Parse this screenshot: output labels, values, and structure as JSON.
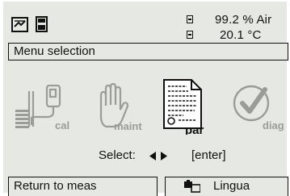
{
  "status": {
    "readings": [
      "99.2 % Air",
      "20.1 °C"
    ],
    "icons": [
      "calibration-status-icon",
      "sensor-status-icon"
    ]
  },
  "menu": {
    "title": "Menu selection",
    "items": [
      {
        "label": "cal",
        "icon": "calibration-icon"
      },
      {
        "label": "maint",
        "icon": "hand-icon"
      },
      {
        "label": "par",
        "icon": "document-icon"
      },
      {
        "label": "diag",
        "icon": "checkmark-icon"
      }
    ]
  },
  "select": {
    "label": "Select:",
    "arrows": "◀ ▶",
    "enter": "[enter]"
  },
  "softkeys": {
    "left": "Return to meas",
    "right": "Lingua"
  }
}
